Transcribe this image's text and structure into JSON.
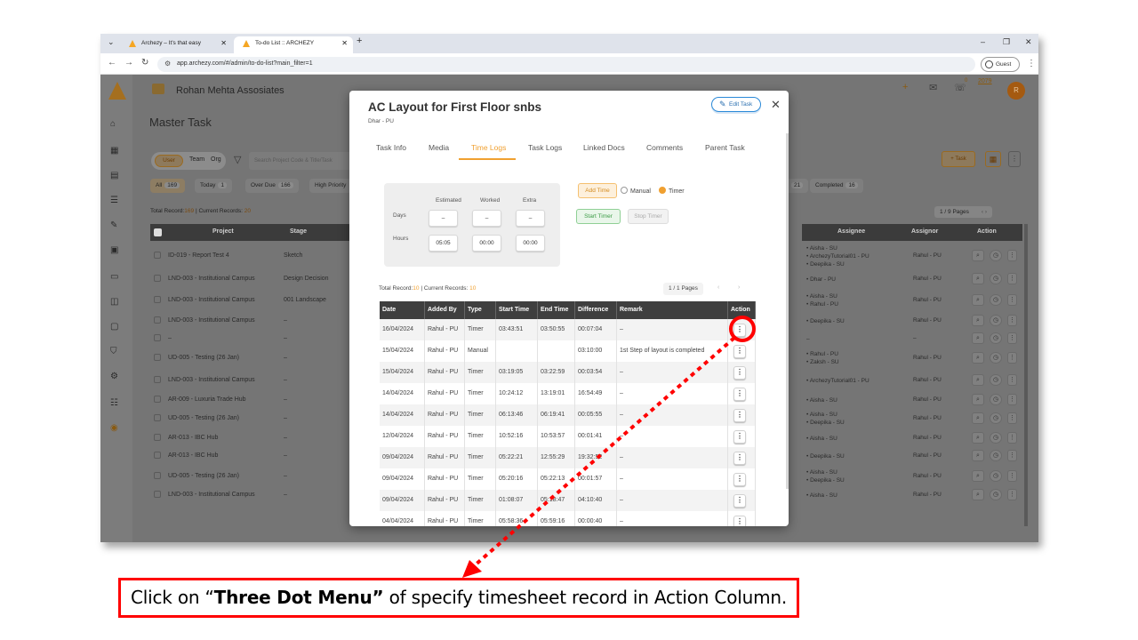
{
  "browser": {
    "tabs": [
      {
        "title": "Archezy – It's that easy",
        "active": false
      },
      {
        "title": "To-do List :: ARCHEZY",
        "active": true
      }
    ],
    "url": "app.archezy.com/#/admin/to-do-list?main_filter=1",
    "profile_label": "Guest"
  },
  "app": {
    "company": "Rohan Mehta Assosiates",
    "page_title": "Master Task",
    "scope_tabs": [
      "User",
      "Team",
      "Org"
    ],
    "search_placeholder": "Search Project Code & Title/Task",
    "filters": [
      {
        "label": "All",
        "count": "169"
      },
      {
        "label": "Today",
        "count": "1"
      },
      {
        "label": "Over Due",
        "count": "166"
      },
      {
        "label": "High Priority",
        "count": ""
      }
    ],
    "filters_right": [
      {
        "label": "",
        "count": "21"
      },
      {
        "label": "Completed",
        "count": "16"
      }
    ],
    "task_button": "+ Task",
    "notification_count": "0",
    "points": "2079",
    "avatar_letter": "R",
    "total_label": "Total Record:",
    "total_value": "169",
    "current_label": " | Current Records: ",
    "current_value": "20",
    "pages": "1 / 9 Pages",
    "columns_left": [
      "Project",
      "Stage"
    ],
    "columns_right": [
      "Assignee",
      "Assignor",
      "Action"
    ],
    "rows": [
      {
        "project": "ID-019 - Report Test 4",
        "stage": "Sketch",
        "assignee": [
          "Aisha - SU",
          "ArchezyTutorial01 - PU",
          "Deepika - SU"
        ],
        "assignor": "Rahul - PU"
      },
      {
        "project": "LND-003 - Institutional Campus",
        "stage": "Design Decision",
        "assignee": [
          "Dhar - PU"
        ],
        "assignor": "Rahul - PU"
      },
      {
        "project": "LND-003 - Institutional Campus",
        "stage": "001 Landscape",
        "assignee": [
          "Aisha - SU",
          "Rahul - PU"
        ],
        "assignor": "Rahul - PU"
      },
      {
        "project": "LND-003 - Institutional Campus",
        "stage": "–",
        "assignee": [
          "Deepika - SU"
        ],
        "assignor": "Rahul - PU"
      },
      {
        "project": "–",
        "stage": "–",
        "assignee": [
          "–"
        ],
        "assignor": "–"
      },
      {
        "project": "UD-005 - Testing (26 Jan)",
        "stage": "–",
        "assignee": [
          "Rahul - PU",
          "Zaksh - SU"
        ],
        "assignor": "Rahul - PU"
      },
      {
        "project": "LND-003 - Institutional Campus",
        "stage": "–",
        "assignee": [
          "ArchezyTutorial01 - PU"
        ],
        "assignor": "Rahul - PU"
      },
      {
        "project": "AR-009 - Luxuria Trade Hub",
        "stage": "–",
        "assignee": [
          "Aisha - SU"
        ],
        "assignor": "Rahul - PU"
      },
      {
        "project": "UD-005 - Testing (26 Jan)",
        "stage": "–",
        "assignee": [
          "Aisha - SU",
          "Deepika - SU"
        ],
        "assignor": "Rahul - PU"
      },
      {
        "project": "AR-013 - IBC Hub",
        "stage": "–",
        "assignee": [
          "Aisha - SU"
        ],
        "assignor": "Rahul - PU"
      },
      {
        "project": "AR-013 - IBC Hub",
        "stage": "–",
        "assignee": [
          "Deepika - SU"
        ],
        "assignor": "Rahul - PU"
      },
      {
        "project": "UD-005 - Testing (26 Jan)",
        "stage": "–",
        "assignee": [
          "Aisha - SU",
          "Deepika - SU"
        ],
        "assignor": "Rahul - PU"
      },
      {
        "project": "LND-003 - Institutional Campus",
        "stage": "–",
        "assignee": [
          "Aisha - SU"
        ],
        "assignor": "Rahul - PU"
      }
    ]
  },
  "modal": {
    "title": "AC Layout for First Floor snbs",
    "subtitle": "Dhar - PU",
    "edit_label": "Edit Task",
    "tabs": [
      "Task Info",
      "Media",
      "Time Logs",
      "Task Logs",
      "Linked Docs",
      "Comments",
      "Parent Task"
    ],
    "active_tab": "Time Logs",
    "panel": {
      "col_estimated": "Estimated",
      "col_worked": "Worked",
      "col_extra": "Extra",
      "row_days": "Days",
      "row_hours": "Hours",
      "days": [
        "–",
        "–",
        "–"
      ],
      "hours": [
        "05:05",
        "00:00",
        "00:00"
      ]
    },
    "add_time": "Add Time",
    "mode_manual": "Manual",
    "mode_timer": "Timer",
    "start_timer": "Start Timer",
    "stop_timer": "Stop Timer",
    "total_label": "Total Record:",
    "total_value": "10",
    "current_label": " | Current Records: ",
    "current_value": "10",
    "pages": "1 / 1 Pages",
    "columns": [
      "Date",
      "Added By",
      "Type",
      "Start Time",
      "End Time",
      "Difference",
      "Remark",
      "Action"
    ],
    "rows": [
      [
        "16/04/2024",
        "Rahul - PU",
        "Timer",
        "03:43:51",
        "03:50:55",
        "00:07:04",
        "–"
      ],
      [
        "15/04/2024",
        "Rahul - PU",
        "Manual",
        "",
        "",
        "03:10:00",
        "1st Step of layout is completed"
      ],
      [
        "15/04/2024",
        "Rahul - PU",
        "Timer",
        "03:19:05",
        "03:22:59",
        "00:03:54",
        "–"
      ],
      [
        "14/04/2024",
        "Rahul - PU",
        "Timer",
        "10:24:12",
        "13:19:01",
        "16:54:49",
        "–"
      ],
      [
        "14/04/2024",
        "Rahul - PU",
        "Timer",
        "06:13:46",
        "06:19:41",
        "00:05:55",
        "–"
      ],
      [
        "12/04/2024",
        "Rahul - PU",
        "Timer",
        "10:52:16",
        "10:53:57",
        "00:01:41",
        "–"
      ],
      [
        "09/04/2024",
        "Rahul - PU",
        "Timer",
        "05:22:21",
        "12:55:29",
        "19:32:52",
        "–"
      ],
      [
        "09/04/2024",
        "Rahul - PU",
        "Timer",
        "05:20:16",
        "05:22:13",
        "00:01:57",
        "–"
      ],
      [
        "09/04/2024",
        "Rahul - PU",
        "Timer",
        "01:08:07",
        "05:18:47",
        "04:10:40",
        "–"
      ],
      [
        "04/04/2024",
        "Rahul - PU",
        "Timer",
        "05:58:36",
        "05:59:16",
        "00:00:40",
        "–"
      ]
    ]
  },
  "annotation": {
    "prefix": "Click on “",
    "bold": "Three Dot Menu”",
    "suffix": " of specify timesheet record in Action Column.",
    "color": "#ff0000"
  }
}
